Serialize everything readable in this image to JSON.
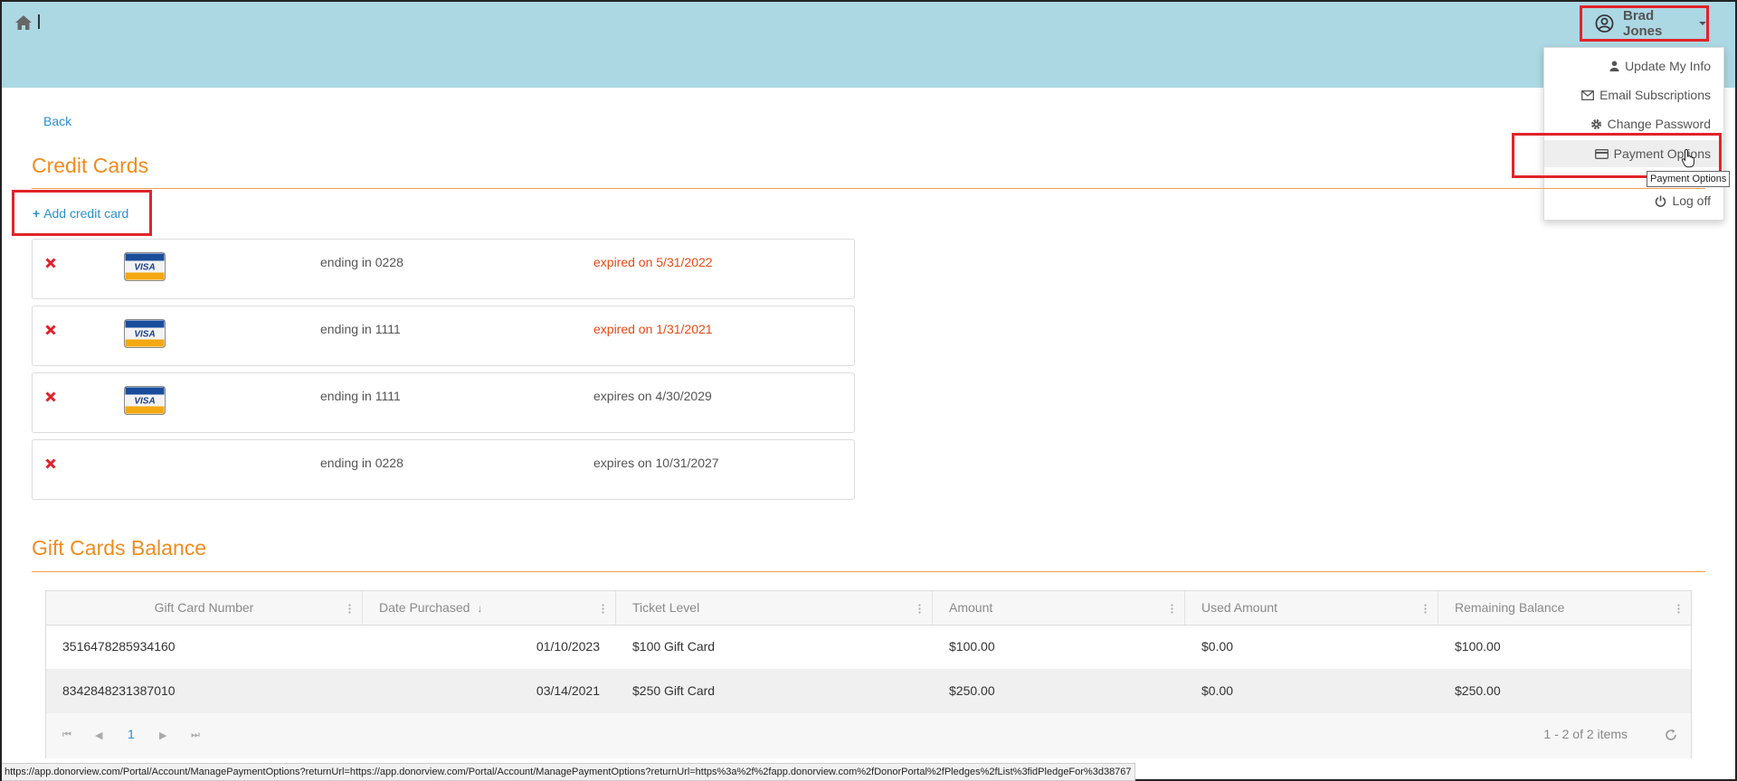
{
  "header": {
    "user_name": "Brad Jones",
    "menu": [
      {
        "label": "Update My Info",
        "icon": "user-icon"
      },
      {
        "label": "Email Subscriptions",
        "icon": "envelope-icon"
      },
      {
        "label": "Change Password",
        "icon": "gear-icon"
      },
      {
        "label": "Payment Options",
        "icon": "credit-card-icon"
      },
      {
        "label": "Log off",
        "icon": "power-icon"
      }
    ],
    "tooltip": "Payment Options"
  },
  "nav": {
    "back_label": "Back"
  },
  "credit_cards": {
    "title": "Credit Cards",
    "add_label": "Add credit card",
    "cards": [
      {
        "brand": "VISA",
        "ending": "ending in 0228",
        "expiry": "expired on 5/31/2022",
        "expired": true
      },
      {
        "brand": "VISA",
        "ending": "ending in 1111",
        "expiry": "expired on 1/31/2021",
        "expired": true
      },
      {
        "brand": "VISA",
        "ending": "ending in 1111",
        "expiry": "expires on 4/30/2029",
        "expired": false
      },
      {
        "brand": "",
        "ending": "ending in 0228",
        "expiry": "expires on 10/31/2027",
        "expired": false
      }
    ]
  },
  "gift_cards": {
    "title": "Gift Cards Balance",
    "columns": [
      "Gift Card Number",
      "Date Purchased",
      "Ticket Level",
      "Amount",
      "Used Amount",
      "Remaining Balance"
    ],
    "rows": [
      [
        "3516478285934160",
        "01/10/2023",
        "$100 Gift Card",
        "$100.00",
        "$0.00",
        "$100.00"
      ],
      [
        "8342848231387010",
        "03/14/2021",
        "$250 Gift Card",
        "$250.00",
        "$0.00",
        "$250.00"
      ]
    ],
    "pager": {
      "current_page": "1",
      "info": "1 - 2 of 2 items"
    }
  },
  "status_url": "https://app.donorview.com/Portal/Account/ManagePaymentOptions?returnUrl=https://app.donorview.com/Portal/Account/ManagePaymentOptions?returnUrl=https%3a%2f%2fapp.donorview.com%2fDonorPortal%2fPledges%2fList%3fidPledgeFor%3d38767",
  "colors": {
    "accent_orange": "#f08c1e",
    "link_blue": "#2a8fd0",
    "expired_red": "#e84a12",
    "header_bg": "#acd8e4",
    "highlight_red": "#e0242a"
  }
}
